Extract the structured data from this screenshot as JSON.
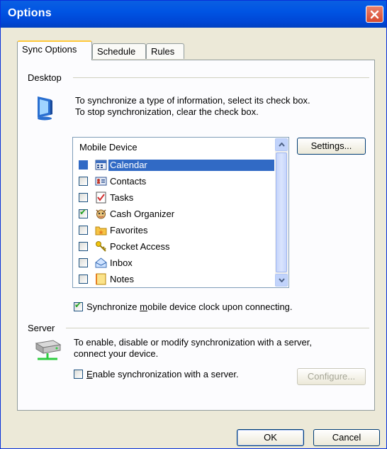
{
  "window": {
    "title": "Options"
  },
  "tabs": [
    {
      "label": "Sync Options",
      "active": true
    },
    {
      "label": "Schedule",
      "active": false
    },
    {
      "label": "Rules",
      "active": false
    }
  ],
  "desktop": {
    "group_label": "Desktop",
    "instructions_line1": "To synchronize a type of information, select its check box.",
    "instructions_line2": "To stop synchronization, clear the check box.",
    "list_header": "Mobile Device",
    "items": [
      {
        "label": "Calendar",
        "checked": false,
        "selected": true,
        "icon": "calendar-icon"
      },
      {
        "label": "Contacts",
        "checked": false,
        "selected": false,
        "icon": "contacts-icon"
      },
      {
        "label": "Tasks",
        "checked": false,
        "selected": false,
        "icon": "tasks-icon"
      },
      {
        "label": "Cash Organizer",
        "checked": true,
        "selected": false,
        "icon": "cash-organizer-icon"
      },
      {
        "label": "Favorites",
        "checked": false,
        "selected": false,
        "icon": "favorites-folder-icon"
      },
      {
        "label": "Pocket Access",
        "checked": false,
        "selected": false,
        "icon": "pocket-access-key-icon"
      },
      {
        "label": "Inbox",
        "checked": false,
        "selected": false,
        "icon": "inbox-icon"
      },
      {
        "label": "Notes",
        "checked": false,
        "selected": false,
        "icon": "notes-icon"
      }
    ],
    "settings_button": "Settings...",
    "clock_sync": {
      "label_pre": "Synchronize ",
      "label_mnemonic": "m",
      "label_post": "obile device clock upon connecting.",
      "checked": true
    }
  },
  "server": {
    "group_label": "Server",
    "instructions_line1": "To enable, disable or modify synchronization with a server,",
    "instructions_line2": "connect your device.",
    "enable": {
      "label_mnemonic": "E",
      "label_post": "nable synchronization with a server.",
      "checked": false
    },
    "configure_button": "Configure..."
  },
  "footer": {
    "ok": "OK",
    "cancel": "Cancel"
  },
  "colors": {
    "titlebar": "#0054e3",
    "selection": "#316ac5",
    "tab_highlight": "#ffc83c",
    "close": "#d6492e"
  }
}
